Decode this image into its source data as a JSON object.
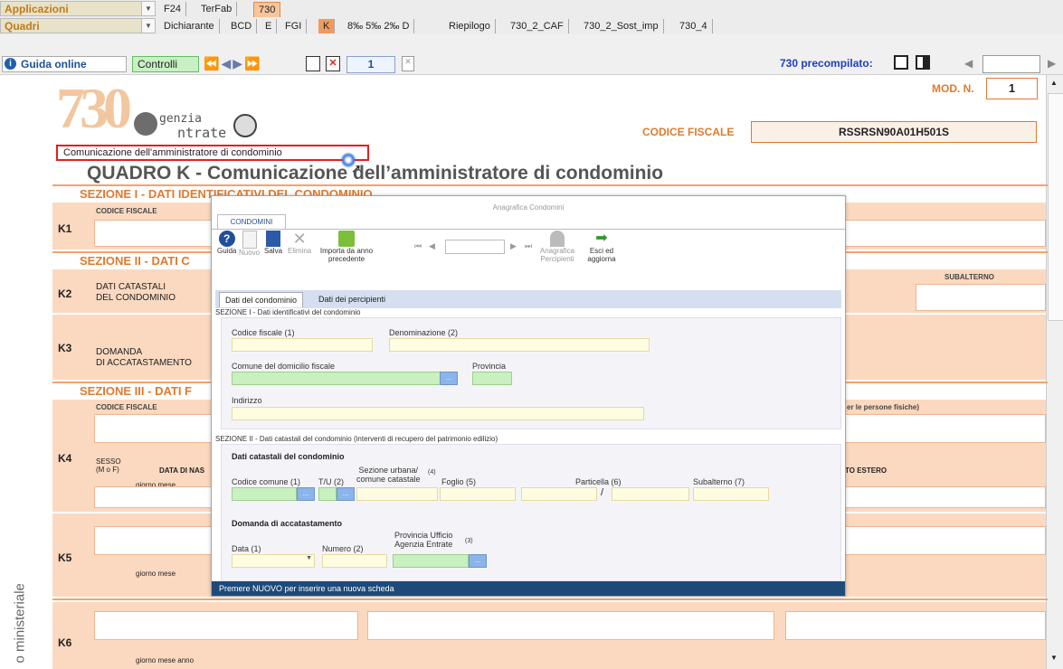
{
  "topbar": {
    "applicazioni": "Applicazioni",
    "quadri": "Quadri",
    "app_tabs": [
      "F24",
      "TerFab",
      "730"
    ],
    "quadri_tabs": [
      "Dichiarante",
      "BCD",
      "E",
      "FGI",
      "K",
      "8‰ 5‰ 2‰ D",
      "Riepilogo",
      "730_2_CAF",
      "730_2_Sost_imp",
      "730_4"
    ],
    "guida_online": "Guida online",
    "controlli": "Controlli",
    "page_num": "1",
    "precompilato": "730 precompilato:"
  },
  "form": {
    "mod_n_label": "MOD. N.",
    "mod_n_value": "1",
    "agenzia_a": "genzia",
    "agenzia_b": "ntrate",
    "codice_fiscale_label": "CODICE FISCALE",
    "codice_fiscale_value": "RSSRSN90A01H501S",
    "subtitle": "Comunicazione dell'amministratore di condominio",
    "title_bold": "QUADRO K - ",
    "title_rest": "Comunicazione dell’amministratore di condominio",
    "sez1": "SEZIONE I - DATI IDENTIFICATIVI DEL CONDOMINIO",
    "sez2": "SEZIONE II - DATI C",
    "sez3": "SEZIONE III - DATI F",
    "k1": "K1",
    "k2": "K2",
    "k3": "K3",
    "k4": "K4",
    "k5": "K5",
    "k6": "K6",
    "k1_cf": "CODICE FISCALE",
    "k2_label": "DATI CATASTALI\nDEL CONDOMINIO",
    "k3_label": "DOMANDA\nDI ACCATASTAMENTO",
    "k4_cf": "CODICE FISCALE",
    "k4_sesso": "SESSO\n(M o F)",
    "k4_data": "DATA DI NAS",
    "k4_giorno": "giorno   mese",
    "k4_persone": "er le persone fisiche)",
    "k4_estero": "TO ESTERO",
    "subalterno": "SUBALTERNO",
    "k5_giorno": "giorno   mese",
    "k6_giorno": "giorno   mese   anno",
    "side_text": "o ministeriale"
  },
  "dialog": {
    "window_title": "Anagrafica Condomini",
    "tab": "CONDOMINI",
    "toolbar": {
      "guida": "Guida",
      "nuovo": "Nuovo",
      "salva": "Salva",
      "elimina": "Elimina",
      "importa": "Importa da anno precedente",
      "anagrafica": "Anagrafica Percipienti",
      "esci": "Esci ed aggiorna"
    },
    "subtabs": [
      "Dati del condominio",
      "Dati dei percipienti"
    ],
    "sez1_title": "SEZIONE I - Dati identificativi del condominio",
    "codice_fiscale": "Codice fiscale (1)",
    "denominazione": "Denominazione (2)",
    "comune": "Comune del domicilio fiscale",
    "provincia": "Provincia",
    "indirizzo": "Indirizzo",
    "sez2_title": "SEZIONE II - Dati catastali del condominio (interventi di recupero del patrimonio edilizio)",
    "dati_catastali": "Dati catastali del condominio",
    "codice_comune": "Codice comune (1)",
    "tu": "T/U (2)",
    "sezione_urbana": "Sezione urbana/\ncomune catastale",
    "sezione_urbana_num": "(4)",
    "foglio": "Foglio (5)",
    "particella": "Particella (6)",
    "subalterno": "Subalterno (7)",
    "slash": "/",
    "domanda": "Domanda di accatastamento",
    "data": "Data (1)",
    "numero": "Numero (2)",
    "provincia_ufficio": "Provincia Ufficio\nAgenzia Entrate",
    "provincia_ufficio_num": "(3)",
    "status": "Premere NUOVO per inserire una nuova scheda"
  }
}
